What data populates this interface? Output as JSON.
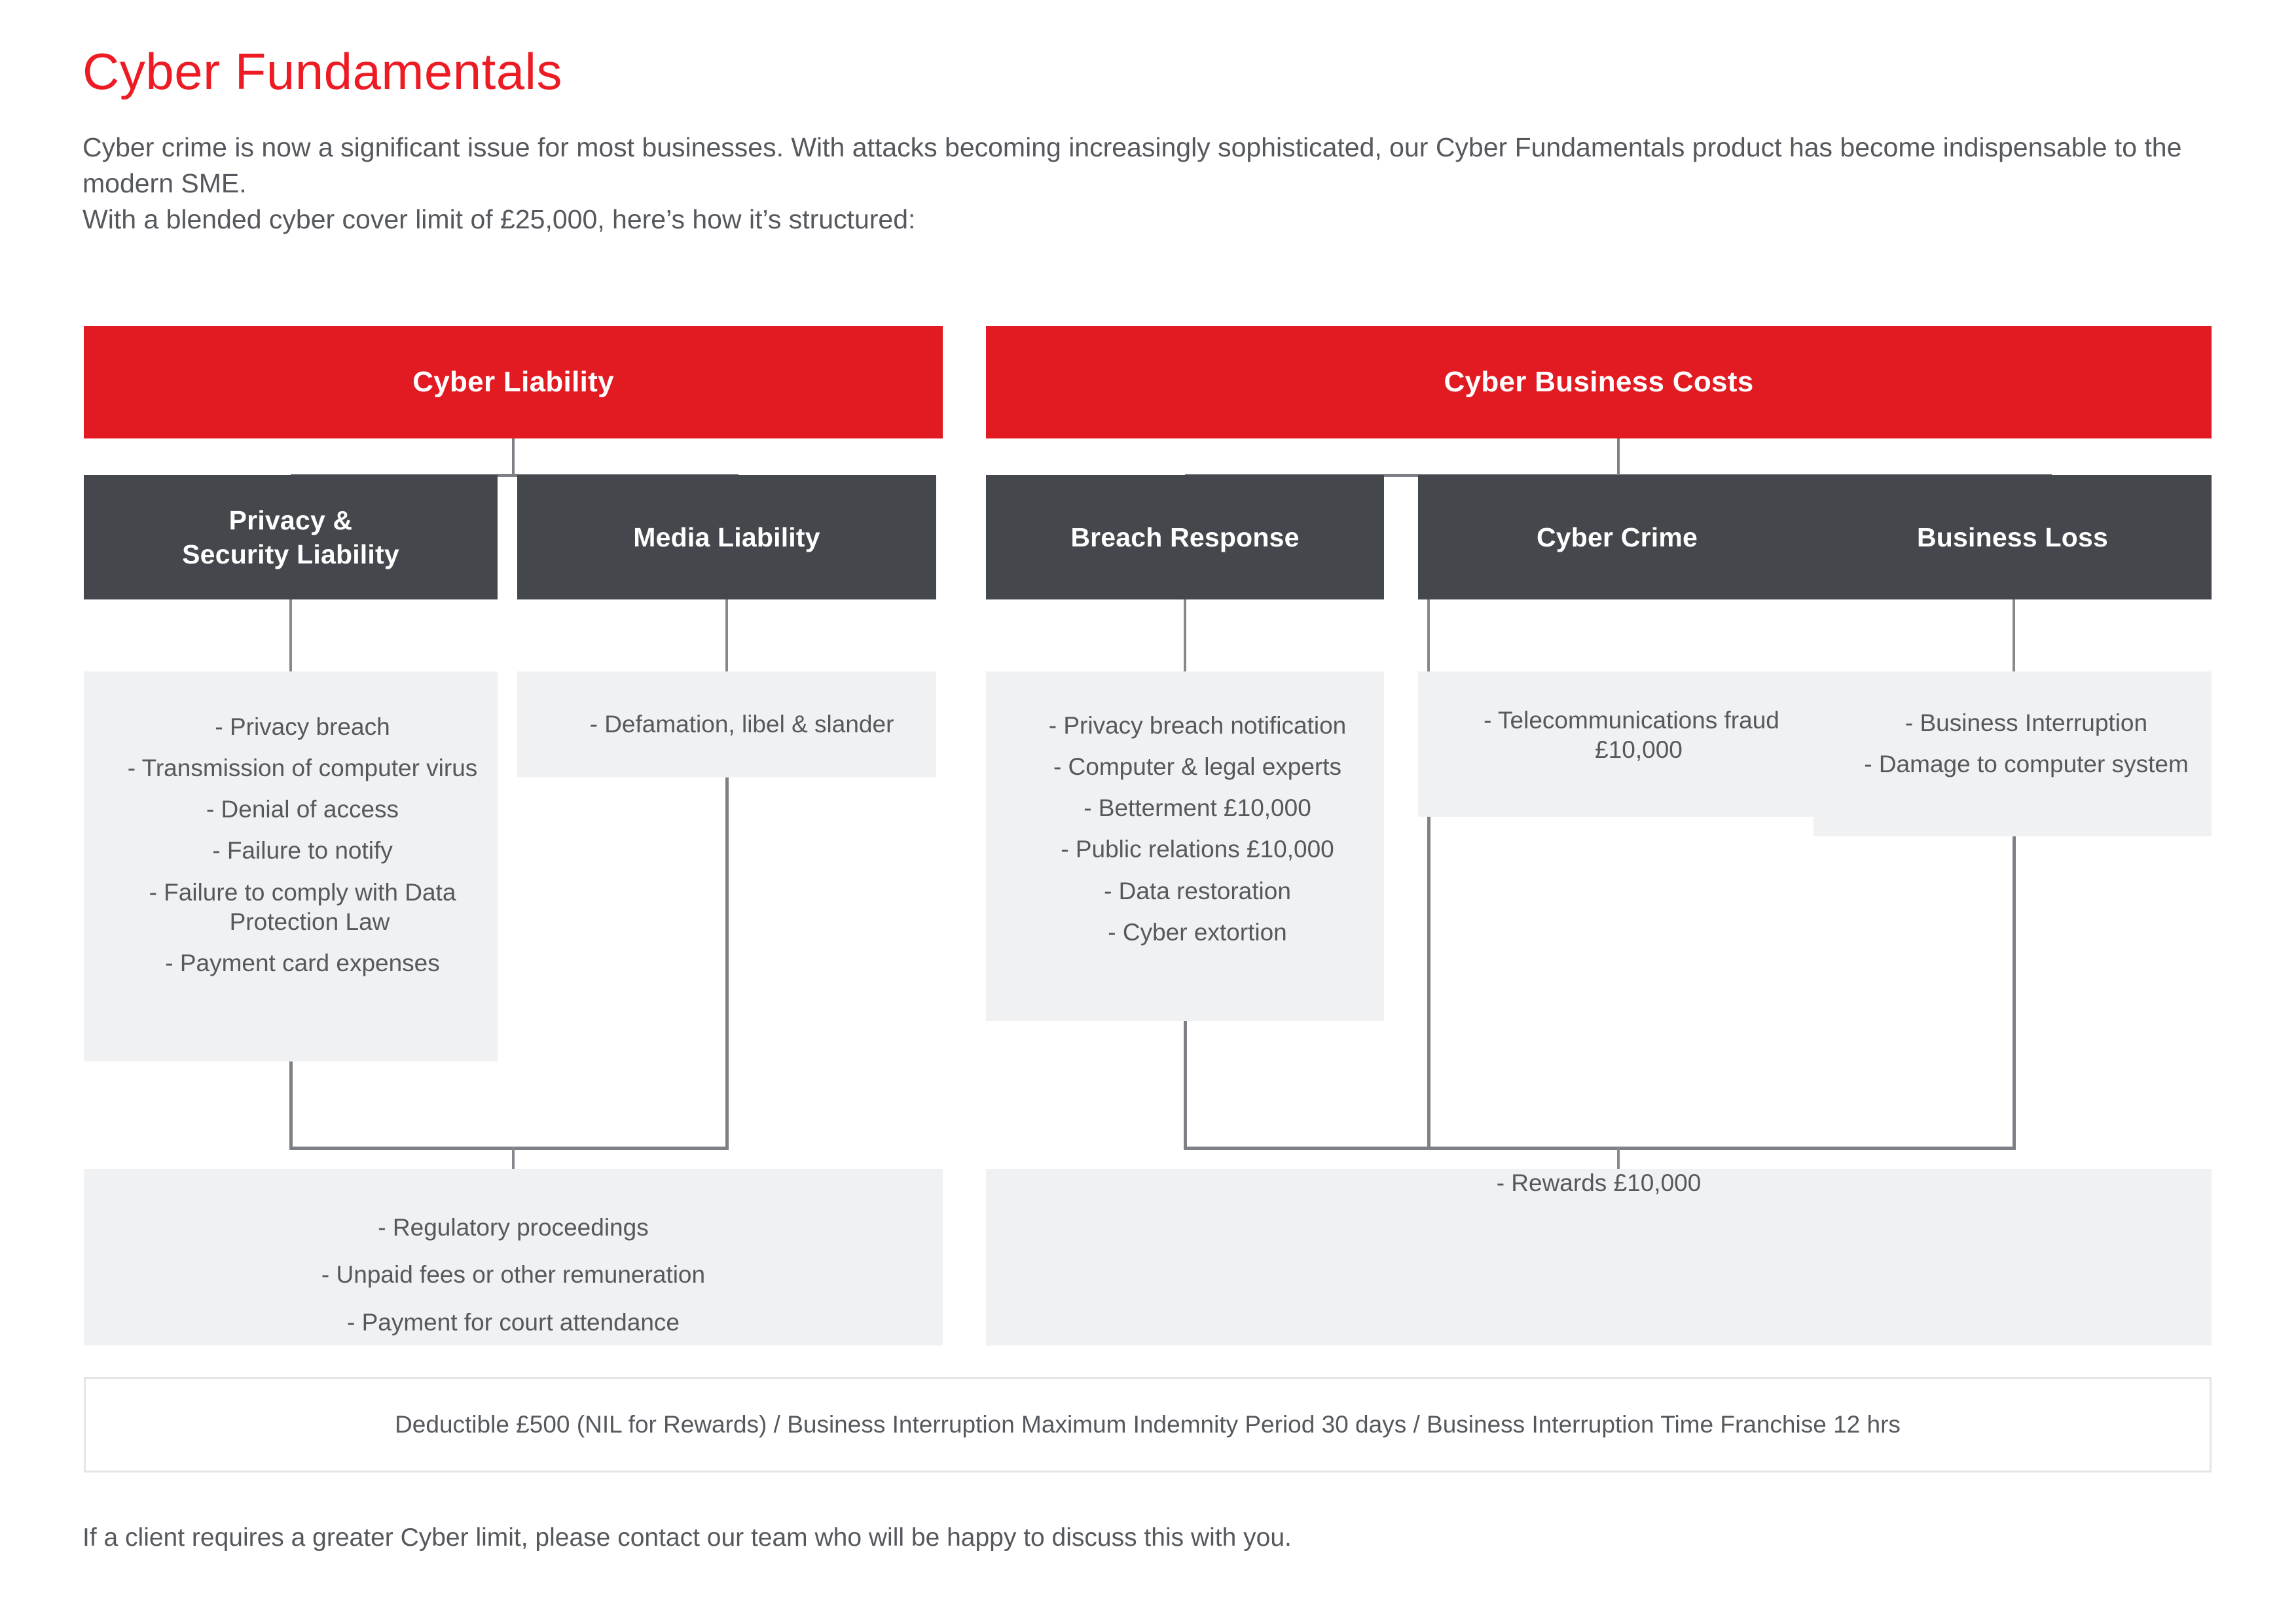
{
  "page": {
    "title": "Cyber Fundamentals",
    "intro_lines": [
      "Cyber crime is now a significant issue for most businesses. With attacks becoming increasingly sophisticated, our Cyber Fundamentals product has become indispensable to the modern SME.",
      "With a blended cyber cover limit of £25,000, here’s how it’s structured:"
    ],
    "footer_bar": "Deductible £500 (NIL for Rewards) / Business Interruption Maximum Indemnity Period 30 days / Business Interruption Time Franchise 12 hrs",
    "footer_note": "If a client requires a greater Cyber limit, please contact our team who will be happy to discuss this with you."
  },
  "colors": {
    "brand_red": "#E21A21",
    "dark_slate": "#44474C",
    "light_panel": "#F0F1F2",
    "connector": "#7d8085",
    "body_text": "#55585d",
    "footer_border": "#E3E5E8"
  },
  "left_panel": {
    "header": "Cyber Liability",
    "categories": [
      {
        "title_line1": "Privacy &",
        "title_line2": "Security Liability"
      },
      {
        "title_line1": "Media Liability",
        "title_line2": ""
      }
    ],
    "privacy_items": [
      "- Privacy breach",
      "- Transmission of computer virus",
      "- Denial of access",
      "- Failure to notify",
      "- Failure to comply with Data\n  Protection Law",
      "- Payment card expenses"
    ],
    "media_items": [
      "- Defamation, libel & slander"
    ],
    "shared_items": [
      "- Regulatory proceedings",
      "- Unpaid fees or other remuneration",
      "- Payment for court attendance"
    ]
  },
  "right_panel": {
    "header": "Cyber Business Costs",
    "categories": [
      {
        "title_line1": "Breach Response",
        "title_line2": ""
      },
      {
        "title_line1": "Cyber Crime",
        "title_line2": ""
      },
      {
        "title_line1": "Business Loss",
        "title_line2": ""
      }
    ],
    "breach_response_items": [
      "- Privacy breach notification",
      "- Computer & legal experts",
      "- Betterment £10,000",
      "- Public relations £10,000",
      "- Data restoration",
      "- Cyber extortion"
    ],
    "cyber_crime_items": [
      "- Telecommunications fraud\n  £10,000"
    ],
    "business_loss_items": [
      "- Business Interruption",
      "- Damage to computer system"
    ],
    "shared_items": [
      "- Rewards £10,000"
    ]
  }
}
